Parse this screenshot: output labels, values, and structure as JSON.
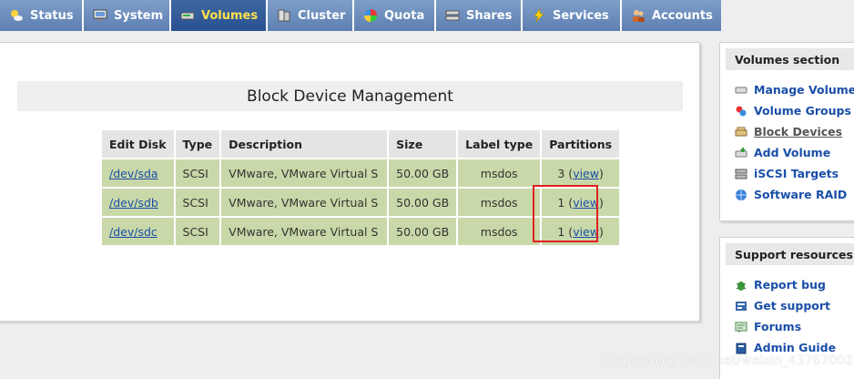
{
  "tabs": [
    {
      "label": "Status",
      "icon": "sun-cloud-icon",
      "active": false
    },
    {
      "label": "System",
      "icon": "monitor-icon",
      "active": false
    },
    {
      "label": "Volumes",
      "icon": "disk-drive-icon",
      "active": true
    },
    {
      "label": "Cluster",
      "icon": "servers-icon",
      "active": false
    },
    {
      "label": "Quota",
      "icon": "pie-icon",
      "active": false
    },
    {
      "label": "Shares",
      "icon": "drive-stack-icon",
      "active": false
    },
    {
      "label": "Services",
      "icon": "lightning-icon",
      "active": false
    },
    {
      "label": "Accounts",
      "icon": "users-icon",
      "active": false
    }
  ],
  "main": {
    "title": "Block Device Management",
    "table": {
      "headers": [
        "Edit Disk",
        "Type",
        "Description",
        "Size",
        "Label type",
        "Partitions"
      ],
      "rows": [
        {
          "disk": "/dev/sda",
          "type": "SCSI",
          "description": "VMware, VMware Virtual S",
          "size": "50.00 GB",
          "label": "msdos",
          "partitions": "3",
          "view": "view"
        },
        {
          "disk": "/dev/sdb",
          "type": "SCSI",
          "description": "VMware, VMware Virtual S",
          "size": "50.00 GB",
          "label": "msdos",
          "partitions": "1",
          "view": "view"
        },
        {
          "disk": "/dev/sdc",
          "type": "SCSI",
          "description": "VMware, VMware Virtual S",
          "size": "50.00 GB",
          "label": "msdos",
          "partitions": "1",
          "view": "view"
        }
      ]
    }
  },
  "volumes_section": {
    "title": "Volumes section",
    "items": [
      {
        "label": "Manage Volumes",
        "icon": "drive-icon"
      },
      {
        "label": "Volume Groups",
        "icon": "colored-balls-icon"
      },
      {
        "label": "Block Devices",
        "icon": "block-device-icon"
      },
      {
        "label": "Add Volume",
        "icon": "add-disk-icon"
      },
      {
        "label": "iSCSI Targets",
        "icon": "server-icon"
      },
      {
        "label": "Software RAID",
        "icon": "globe-icon"
      }
    ]
  },
  "support_section": {
    "title": "Support resources",
    "items": [
      {
        "label": "Report bug",
        "icon": "bug-icon"
      },
      {
        "label": "Get support",
        "icon": "support-icon"
      },
      {
        "label": "Forums",
        "icon": "forum-icon"
      },
      {
        "label": "Admin Guide",
        "icon": "book-icon"
      }
    ]
  },
  "watermark": "https://blog.csdn.net/weixin_43767002",
  "colors": {
    "tab": "#6c8ec0",
    "tab_active": "#3560a0",
    "tab_active_text": "#ffe14a",
    "row_bg": "#c9d8a8",
    "header_bg": "#e4e4e4",
    "link": "#1a4fa8",
    "highlight": "#e02020"
  }
}
